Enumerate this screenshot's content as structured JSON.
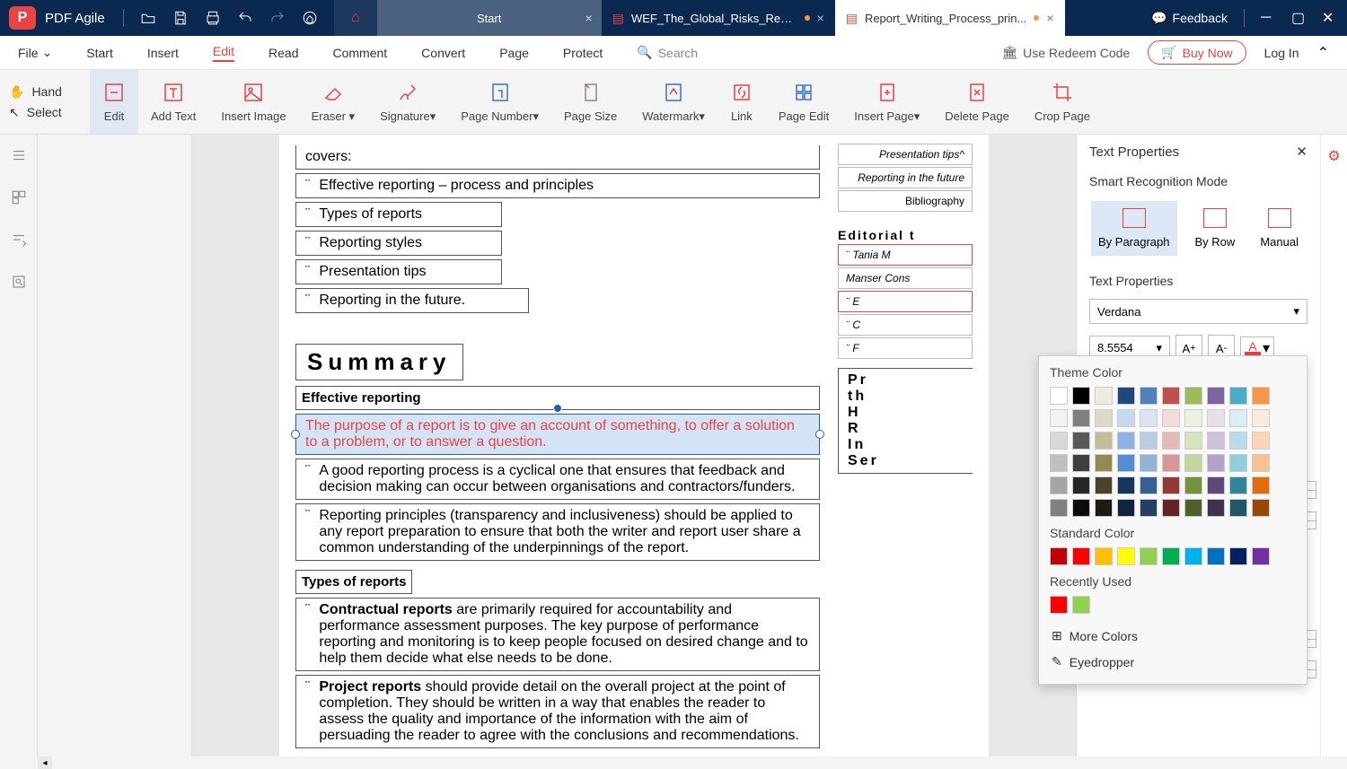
{
  "app": {
    "name": "PDF Agile"
  },
  "tabs": {
    "start": "Start",
    "doc1": "WEF_The_Global_Risks_Repo...",
    "doc2": "Report_Writing_Process_prin..."
  },
  "titlebar": {
    "feedback": "Feedback"
  },
  "menu": {
    "file": "File",
    "start": "Start",
    "insert": "Insert",
    "edit": "Edit",
    "read": "Read",
    "comment": "Comment",
    "convert": "Convert",
    "page": "Page",
    "protect": "Protect",
    "search_ph": "Search",
    "redeem": "Use Redeem Code",
    "buy": "Buy Now",
    "login": "Log In"
  },
  "toolbar": {
    "hand": "Hand",
    "select": "Select",
    "edit": "Edit",
    "add_text": "Add Text",
    "insert_image": "Insert Image",
    "eraser": "Eraser",
    "signature": "Signature",
    "page_number": "Page Number",
    "page_size": "Page Size",
    "watermark": "Watermark",
    "link": "Link",
    "page_edit": "Page Edit",
    "insert_page": "Insert Page",
    "delete_page": "Delete Page",
    "crop_page": "Crop Page"
  },
  "doc": {
    "covers": "covers:",
    "b1": "Effective reporting – process and principles",
    "b2": "Types of reports",
    "b3": "Reporting styles",
    "b4": "Presentation tips",
    "b5": "Reporting in the future.",
    "summary": "Summary",
    "h3a": "Effective reporting",
    "p1": "The purpose of a report is to give an account of something, to offer a solution to a problem, or to answer a question.",
    "p2": "A good reporting process is a cyclical one that ensures that feedback and decision making can occur between organisations and contractors/funders.",
    "p3": "Reporting principles (transparency and inclusiveness) should be applied to any report preparation to ensure that both the writer and report user share a common understanding of the underpinnings of the report.",
    "h3b": "Types of reports",
    "p4a": "Contractual reports",
    "p4b": " are primarily required for accountability and performance assessment purposes. The key purpose of performance reporting and monitoring is to keep people focused on desired change and to help them decide what else needs to be done.",
    "p5a": "Project reports",
    "p5b": " should provide detail on the overall project at the point of completion.  They should be written in a way that enables the reader to assess the quality and importance of the information with the aim of persuading the reader to agree with the conclusions and recommendations."
  },
  "sidenav": {
    "n1": "Presentation tips",
    "n2": "Reporting in the future",
    "n3": "Bibliography",
    "sect": "Editorial t",
    "e1": "Tania M",
    "e2": "Manser Cons",
    "e3": "E",
    "e4": "C",
    "e5": "F",
    "box": "Pr\nth\nH\nR\nIn\nSer"
  },
  "panel": {
    "title": "Text Properties",
    "smart": "Smart Recognition Mode",
    "m1": "By Paragraph",
    "m2": "By Row",
    "m3": "Manual",
    "tp": "Text Properties",
    "font": "Verdana",
    "size": "8.5554"
  },
  "colorpop": {
    "theme": "Theme Color",
    "standard": "Standard Color",
    "recent": "Recently Used",
    "more": "More Colors",
    "eyedrop": "Eyedropper",
    "theme_colors": [
      [
        "#ffffff",
        "#000000",
        "#eeece1",
        "#1f497d",
        "#4f81bd",
        "#c0504d",
        "#9bbb59",
        "#8064a2",
        "#4bacc6",
        "#f79646"
      ],
      [
        "#f2f2f2",
        "#7f7f7f",
        "#ddd9c3",
        "#c6d9f0",
        "#dbe5f1",
        "#f2dcdb",
        "#ebf1dd",
        "#e5e0ec",
        "#dbeef3",
        "#fdeada"
      ],
      [
        "#d8d8d8",
        "#595959",
        "#c4bd97",
        "#8db3e2",
        "#b8cce4",
        "#e5b9b7",
        "#d7e3bc",
        "#ccc1d9",
        "#b7dde8",
        "#fbd5b5"
      ],
      [
        "#bfbfbf",
        "#3f3f3f",
        "#938953",
        "#548dd4",
        "#95b3d7",
        "#d99694",
        "#c3d69b",
        "#b2a2c7",
        "#92cddc",
        "#fac08f"
      ],
      [
        "#a5a5a5",
        "#262626",
        "#494429",
        "#17365d",
        "#366092",
        "#953734",
        "#76923c",
        "#5f497a",
        "#31859b",
        "#e36c09"
      ],
      [
        "#7f7f7f",
        "#0c0c0c",
        "#1d1b10",
        "#0f243e",
        "#244061",
        "#632423",
        "#4f6128",
        "#3f3151",
        "#205867",
        "#974806"
      ]
    ],
    "standard_colors": [
      "#c00000",
      "#ff0000",
      "#ffc000",
      "#ffff00",
      "#92d050",
      "#00b050",
      "#00b0f0",
      "#0070c0",
      "#002060",
      "#7030a0"
    ],
    "recent_colors": [
      "#ff0000",
      "#92d050"
    ]
  }
}
